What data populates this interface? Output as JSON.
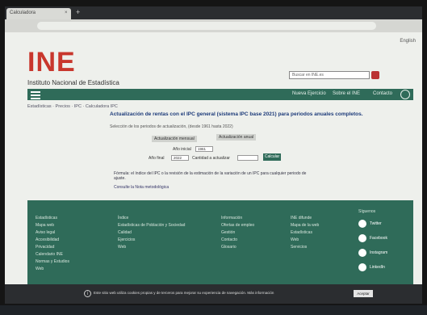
{
  "browser": {
    "tab_title": "Calculadora",
    "tab_close": "×",
    "new_tab": "+"
  },
  "header": {
    "lang": "English",
    "logo": "INE",
    "org_name": "Instituto Nacional de Estadística",
    "search_placeholder": "Buscar en INE.es"
  },
  "nav": {
    "items": [
      "Nueva Ejercicio",
      "Sobre el INE",
      "Contacto"
    ]
  },
  "breadcrumb": "Estadísticas · Precios · IPC · Calculadora IPC",
  "calculator": {
    "title": "Actualización de rentas con el IPC general (sistema IPC base 2021) para periodos anuales completos.",
    "subtitle": "Selección de los periodos de actualización, (desde 1961 hasta 2022)",
    "tab_monthly": "Actualización mensual",
    "tab_annual": "Actualización anual",
    "start_label": "Año inicial",
    "start_value": "1961",
    "end_label": "Año final",
    "end_value": "2022",
    "amount_label": "Cantidad a actualizar",
    "calculate_button": "Calcular"
  },
  "notes": {
    "line1": "Fórmula: el índice del IPC o la revisión de la estimación de la variación de un IPC para cualquier periodo de ajuste.",
    "line2": "Consulte la Nota metodológica"
  },
  "footer": {
    "col1": [
      "Estadísticas",
      "Mapa web",
      "Aviso legal",
      "Accesibilidad",
      "Privacidad",
      "Calendario INE",
      "Normas y Estudios",
      "Web"
    ],
    "col2": [
      "Índice",
      "Estadísticas de Población y Sociedad",
      "Calidad",
      "Ejercicios",
      "Web"
    ],
    "col3": [
      "Información",
      "Ofertas de empleo",
      "Gestión",
      "Contacto",
      "Glosario"
    ],
    "col4": [
      "INE difunde",
      "Mapa de la web",
      "Estadísticas",
      "Web",
      "Servicios"
    ],
    "social_head": "Síguenos",
    "social": [
      "Twitter",
      "Facebook",
      "Instagram",
      "LinkedIn"
    ]
  },
  "cookie": {
    "text": "Este sitio web utiliza cookies propias y de terceros para mejorar su experiencia de navegación. Más información",
    "accept": "Aceptar"
  }
}
